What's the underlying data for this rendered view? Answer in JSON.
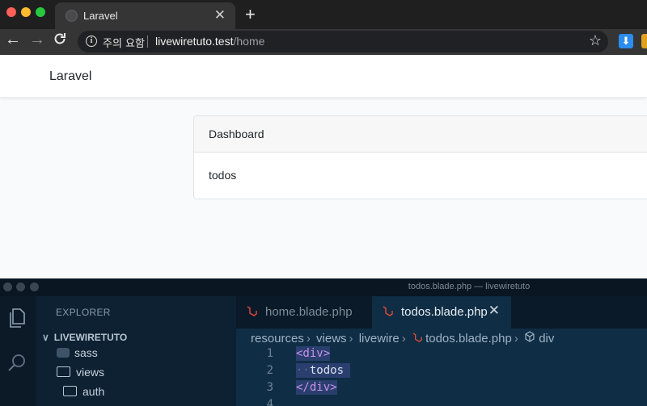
{
  "browser": {
    "tab_title": "Laravel",
    "tab_close": "✕",
    "new_tab": "+",
    "security_label": "주의 요함",
    "url_host": "livewiretuto.test",
    "url_path": "/home"
  },
  "page": {
    "brand": "Laravel",
    "card_header": "Dashboard",
    "card_body": "todos"
  },
  "vscode": {
    "window_title": "todos.blade.php — livewiretuto",
    "explorer_label": "EXPLORER",
    "project": "LIVEWIRETUTO",
    "tree": [
      {
        "label": "sass"
      },
      {
        "label": "views"
      },
      {
        "label": "auth"
      }
    ],
    "tabs": [
      {
        "label": "home.blade.php"
      },
      {
        "label": "todos.blade.php"
      }
    ],
    "breadcrumb": [
      "resources",
      "views",
      "livewire",
      "todos.blade.php",
      "div"
    ],
    "lines": [
      {
        "num": "1",
        "text": "<div>"
      },
      {
        "num": "2",
        "indent": "··",
        "text": "todos"
      },
      {
        "num": "3",
        "text": "</div>"
      },
      {
        "num": "4",
        "text": ""
      }
    ]
  }
}
